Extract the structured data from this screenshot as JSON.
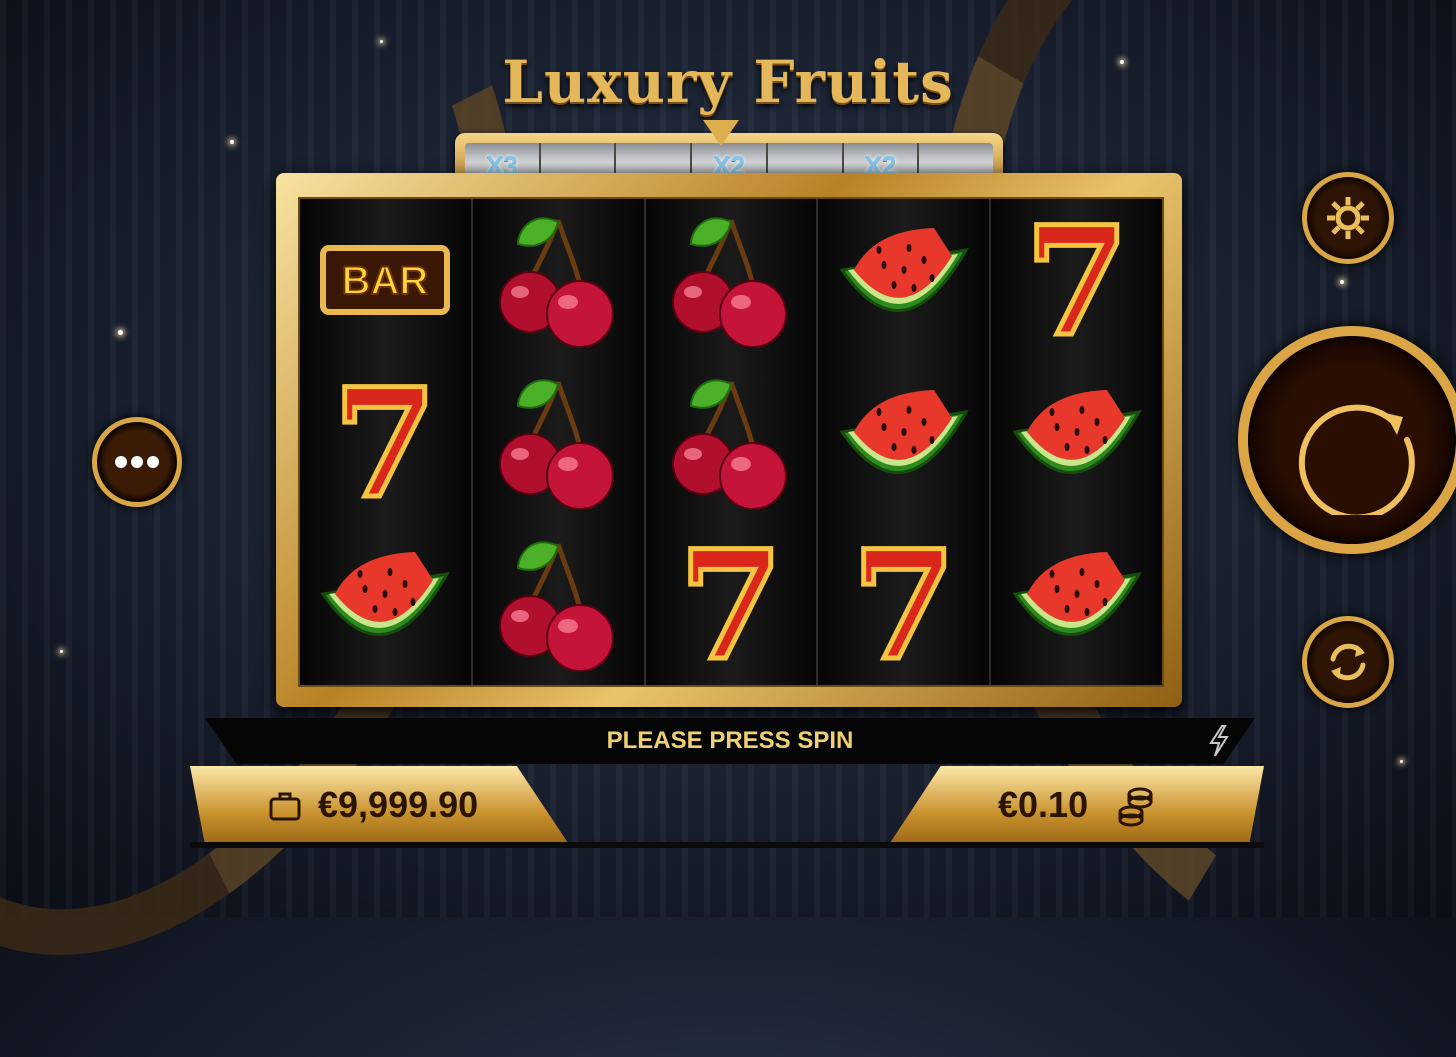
{
  "game": {
    "title": "Luxury Fruits"
  },
  "multipliers": [
    "X3",
    "",
    "",
    "X2",
    "",
    "X2",
    ""
  ],
  "reels": [
    [
      "bar",
      "seven",
      "watermelon"
    ],
    [
      "cherry",
      "cherry",
      "cherry"
    ],
    [
      "cherry",
      "cherry",
      "seven"
    ],
    [
      "watermelon",
      "watermelon",
      "seven"
    ],
    [
      "seven",
      "watermelon",
      "watermelon"
    ]
  ],
  "symbol_text": {
    "bar": "BAR",
    "seven": "7"
  },
  "message": "PLEASE PRESS SPIN",
  "balance": {
    "value": "€9,999.90",
    "icon": "briefcase-icon"
  },
  "bet": {
    "value": "€0.10",
    "icon": "coin-stack-icon"
  },
  "controls": {
    "menu_icon": "more-dots-icon",
    "settings_icon": "gear-icon",
    "spin_icon": "spin-arrow-icon",
    "autoplay_icon": "autoplay-icon",
    "turbo_icon": "lightning-icon"
  },
  "colors": {
    "gold": "#dba546",
    "message": "#f0d070",
    "multiplier": "#86c6ea"
  }
}
